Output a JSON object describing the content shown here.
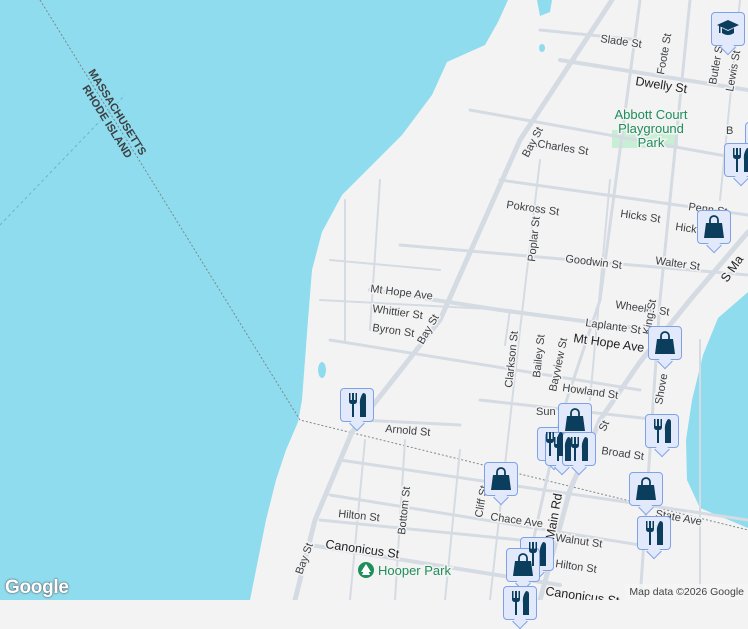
{
  "map": {
    "colors": {
      "water": "#8fdcee",
      "land": "#f4f3f4",
      "road": "#d5dbe2",
      "park": "#c8efd4",
      "marker_icon": "#0b3d5c"
    },
    "state_labels": [
      "MASSACHUSETTS",
      "RHODE ISLAND"
    ],
    "streets": {
      "slade": "Slade St",
      "foote": "Foote St",
      "butler": "Butler St",
      "lewis": "Lewis St",
      "dwelly": "Dwelly St",
      "bay1": "Bay St",
      "bay2": "Bay St",
      "bay3": "Bay St",
      "charles": "Charles St",
      "pokross": "Pokross St",
      "hicks": "Hicks St",
      "penn": "Penn St",
      "hicks2": "Hick",
      "poplar": "Poplar St",
      "goodwin": "Goodwin St",
      "walter": "Walter St",
      "smain": "S Ma",
      "mthope1": "Mt Hope Ave",
      "mthope2": "Mt Hope Ave",
      "wheeler": "Wheeler St",
      "whittier": "Whittier St",
      "king": "King St",
      "laplante": "Laplante St",
      "byron": "Byron St",
      "clarkson": "Clarkson St",
      "bailey": "Bailey St",
      "bayview": "Bayview St",
      "shove": "Shove",
      "howland": "Howland St",
      "sun": "Sun",
      "arnold": "Arnold St",
      "broad": "Broad St",
      "state": "State Ave",
      "cliff": "Cliff St",
      "bottom": "Bottom St",
      "chace": "Chace Ave",
      "mainrd": "Main Rd",
      "hilton1": "Hilton St",
      "hilton2": "Hilton St",
      "walnut": "Walnut St",
      "canonicus1": "Canonicus St",
      "canonicus2": "Canonicus St",
      "st": "St",
      "b": "B"
    },
    "parks": {
      "abbott": [
        "Abbott Court",
        "Playground",
        "Park"
      ],
      "hooper": "Hooper Park"
    },
    "markers": [
      {
        "type": "school"
      },
      {
        "type": "restaurant"
      },
      {
        "type": "restaurant"
      },
      {
        "type": "restaurant"
      },
      {
        "type": "shopping"
      },
      {
        "type": "shopping"
      },
      {
        "type": "restaurant"
      },
      {
        "type": "shopping"
      },
      {
        "type": "restaurant"
      },
      {
        "type": "restaurant"
      },
      {
        "type": "restaurant"
      },
      {
        "type": "shopping"
      },
      {
        "type": "shopping"
      },
      {
        "type": "restaurant"
      },
      {
        "type": "restaurant"
      },
      {
        "type": "shopping"
      },
      {
        "type": "restaurant"
      }
    ],
    "logo": "Google",
    "attribution": "Map data ©2026 Google"
  }
}
